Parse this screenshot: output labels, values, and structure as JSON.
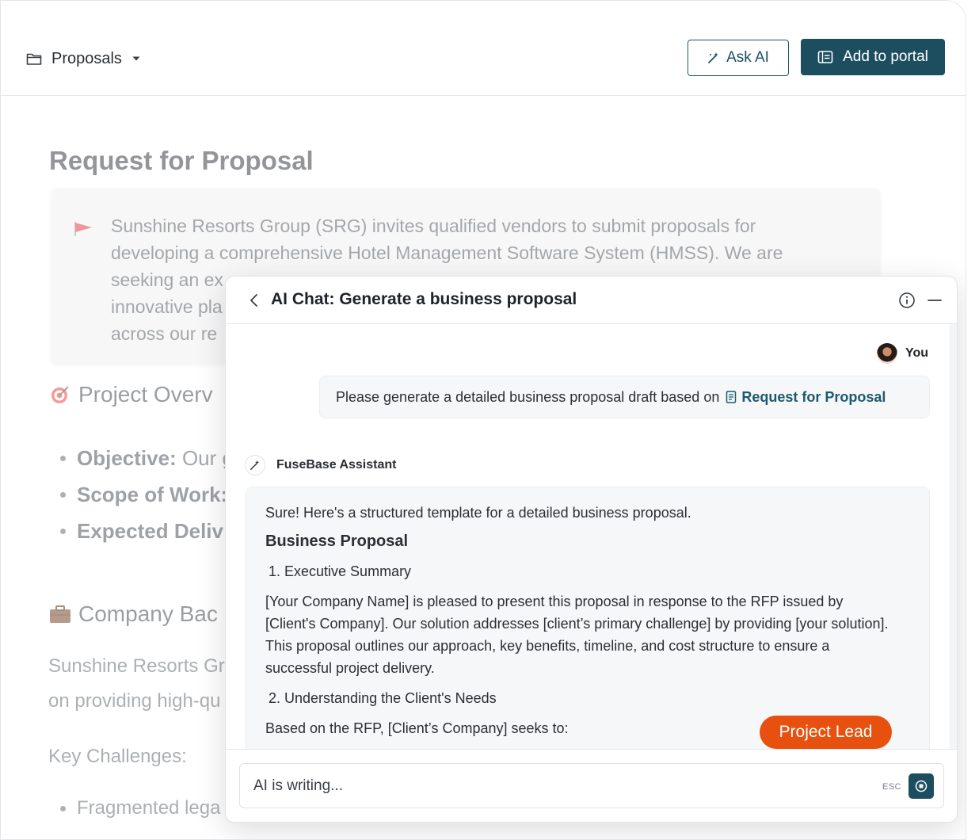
{
  "header": {
    "folder_icon": "folder-icon",
    "breadcrumb": "Proposals",
    "ask_ai_label": "Ask AI",
    "add_to_portal_label": "Add to portal",
    "accent_color": "#1d4e5f"
  },
  "document": {
    "title": "Request for Proposal",
    "callout_lines": [
      "Sunshine Resorts Group (SRG) invites qualified vendors to submit proposals for",
      "developing a comprehensive Hotel Management Software System (HMSS). We are",
      "seeking an ex",
      "innovative pla",
      "across our re"
    ],
    "section_overview": "Project Overv",
    "bullets": [
      {
        "bold": "Objective:",
        "text": " Our g"
      },
      {
        "bold": "Scope of Work:",
        "text": ""
      },
      {
        "bold": "Expected Deliv",
        "text": ""
      }
    ],
    "section_company": "Company Bac",
    "company_lines": [
      "Sunshine Resorts Gr",
      "on providing high-qu"
    ],
    "key_challenges": "Key Challenges:",
    "challenge_bullet": "Fragmented lega"
  },
  "chat": {
    "title": "AI Chat: Generate a business proposal",
    "user_name": "You",
    "user_message": "Please generate a detailed business proposal draft based on",
    "user_link": "Request for Proposal",
    "assistant_name": "FuseBase Assistant",
    "assistant": {
      "intro": "Sure! Here's a structured template for a detailed business proposal.",
      "heading": "Business Proposal",
      "item1": "1. Executive Summary",
      "para1": "[Your Company Name] is pleased to present this proposal in response to the RFP issued by [Client's Company]. Our solution addresses [client’s primary challenge] by providing [your solution]. This proposal outlines our approach, key benefits, timeline, and cost structure to ensure a successful project delivery.",
      "item2": "2. Understanding the Client's Needs",
      "para2": "Based on the RFP, [Client’s Company] seeks to:"
    },
    "pill_label": "Project Lead",
    "pill_color": "#e8500f",
    "input_status": "AI is writing...",
    "esc_label": "ESC"
  }
}
